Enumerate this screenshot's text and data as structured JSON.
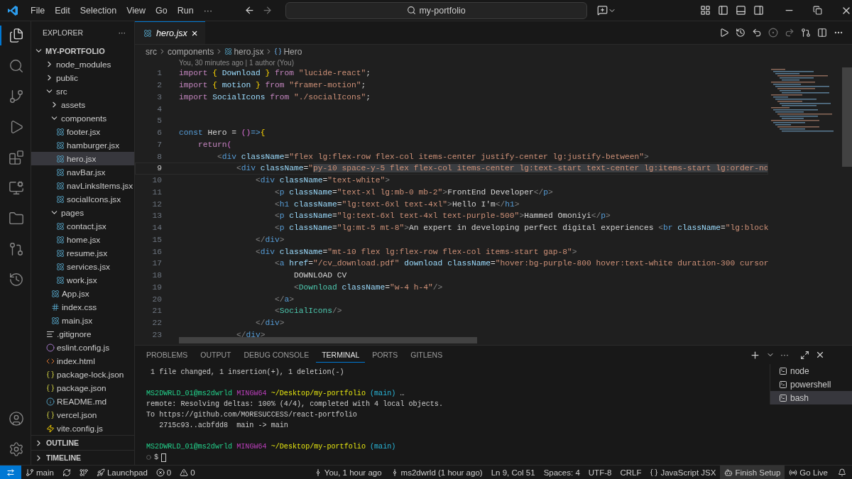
{
  "title_bar": {
    "menus": [
      "File",
      "Edit",
      "Selection",
      "View",
      "Go",
      "Run"
    ],
    "more": "···",
    "search": "my-portfolio"
  },
  "explorer": {
    "title": "EXPLORER",
    "more": "···",
    "root": "MY-PORTFOLIO",
    "items": [
      {
        "name": "node_modules",
        "kind": "folder",
        "expanded": false,
        "selected": false
      },
      {
        "name": "public",
        "kind": "folder",
        "expanded": false,
        "selected": false
      },
      {
        "name": "src",
        "kind": "folder",
        "expanded": true,
        "selected": false,
        "children": [
          {
            "name": "assets",
            "kind": "folder",
            "expanded": false,
            "selected": false
          },
          {
            "name": "components",
            "kind": "folder",
            "expanded": true,
            "selected": false,
            "children": [
              {
                "name": "footer.jsx",
                "kind": "react",
                "selected": false
              },
              {
                "name": "hamburger.jsx",
                "kind": "react",
                "selected": false
              },
              {
                "name": "hero.jsx",
                "kind": "react",
                "selected": true
              },
              {
                "name": "navBar.jsx",
                "kind": "react",
                "selected": false
              },
              {
                "name": "navLinksItems.jsx",
                "kind": "react",
                "selected": false
              },
              {
                "name": "socialIcons.jsx",
                "kind": "react",
                "selected": false
              }
            ]
          },
          {
            "name": "pages",
            "kind": "folder",
            "expanded": true,
            "selected": false,
            "children": [
              {
                "name": "contact.jsx",
                "kind": "react",
                "selected": false
              },
              {
                "name": "home.jsx",
                "kind": "react",
                "selected": false
              },
              {
                "name": "resume.jsx",
                "kind": "react",
                "selected": false
              },
              {
                "name": "services.jsx",
                "kind": "react",
                "selected": false
              },
              {
                "name": "work.jsx",
                "kind": "react",
                "selected": false
              }
            ]
          },
          {
            "name": "App.jsx",
            "kind": "react",
            "selected": false
          },
          {
            "name": "index.css",
            "kind": "css",
            "selected": false
          },
          {
            "name": "main.jsx",
            "kind": "react",
            "selected": false
          }
        ]
      },
      {
        "name": ".gitignore",
        "kind": "git",
        "selected": false
      },
      {
        "name": "eslint.config.js",
        "kind": "eslint",
        "selected": false
      },
      {
        "name": "index.html",
        "kind": "html",
        "selected": false
      },
      {
        "name": "package-lock.json",
        "kind": "json",
        "selected": false
      },
      {
        "name": "package.json",
        "kind": "json",
        "selected": false
      },
      {
        "name": "README.md",
        "kind": "info",
        "selected": false
      },
      {
        "name": "vercel.json",
        "kind": "json",
        "selected": false
      },
      {
        "name": "vite.config.js",
        "kind": "vite",
        "selected": false
      }
    ],
    "sections": [
      "OUTLINE",
      "TIMELINE"
    ]
  },
  "editor": {
    "tab": {
      "label": "hero.jsx",
      "close": "×"
    },
    "breadcrumbs": [
      "src",
      "components",
      "hero.jsx",
      "Hero"
    ],
    "blame": "You, 30 minutes ago | 1 author (You)",
    "lines": [
      {
        "number": "1",
        "current": false,
        "tokens": [
          {
            "text": "import",
            "kind": "control"
          },
          {
            "text": " {",
            "kind": "brace"
          },
          {
            "text": " Download",
            "kind": "variable"
          },
          {
            "text": " }",
            "kind": "brace"
          },
          {
            "text": " from",
            "kind": "control"
          },
          {
            "text": " \"lucide-react\"",
            "kind": "string"
          },
          {
            "text": ";",
            "kind": "plain"
          }
        ]
      },
      {
        "number": "2",
        "current": false,
        "tokens": [
          {
            "text": "import",
            "kind": "control"
          },
          {
            "text": " {",
            "kind": "brace"
          },
          {
            "text": " motion",
            "kind": "variable"
          },
          {
            "text": " }",
            "kind": "brace"
          },
          {
            "text": " from",
            "kind": "control"
          },
          {
            "text": " \"framer-motion\"",
            "kind": "string"
          },
          {
            "text": ";",
            "kind": "plain"
          }
        ]
      },
      {
        "number": "3",
        "current": false,
        "tokens": [
          {
            "text": "import",
            "kind": "control"
          },
          {
            "text": " SocialIcons",
            "kind": "variable"
          },
          {
            "text": " from",
            "kind": "control"
          },
          {
            "text": " \"./socialIcons\"",
            "kind": "string"
          },
          {
            "text": ";",
            "kind": "plain"
          }
        ]
      },
      {
        "number": "4",
        "current": false
      },
      {
        "number": "5",
        "current": false
      },
      {
        "number": "6",
        "current": false,
        "tokens": [
          {
            "text": "const",
            "kind": "storage"
          },
          {
            "text": " Hero = ",
            "kind": "plain"
          },
          {
            "text": "()",
            "kind": "paren"
          },
          {
            "text": "=>",
            "kind": "storage"
          },
          {
            "text": "{",
            "kind": "brace"
          }
        ]
      },
      {
        "number": "7",
        "current": false,
        "tokens": [
          {
            "text": "    return",
            "kind": "control"
          },
          {
            "text": "(",
            "kind": "paren"
          }
        ]
      },
      {
        "number": "8",
        "current": false,
        "tokens": [
          {
            "text": "        <",
            "kind": "bracket"
          },
          {
            "text": "div",
            "kind": "tag"
          },
          {
            "text": " className",
            "kind": "attribute"
          },
          {
            "text": "=",
            "kind": "plain"
          },
          {
            "text": "\"flex lg:flex-row flex-col items-center justify-center lg:justify-between\"",
            "kind": "string"
          },
          {
            "text": ">",
            "kind": "bracket"
          }
        ]
      },
      {
        "number": "9",
        "current": true,
        "tokens": [
          {
            "text": "            <",
            "kind": "bracket"
          },
          {
            "text": "div",
            "kind": "tag"
          },
          {
            "text": " className",
            "kind": "attribute"
          },
          {
            "text": "=",
            "kind": "plain"
          },
          {
            "text": "\"",
            "kind": "string"
          },
          {
            "text": "py-10 space-y-5 flex flex-col items-center lg:text-start text-center lg:items-start lg:order-no",
            "kind": "selection"
          }
        ]
      },
      {
        "number": "10",
        "current": false,
        "tokens": [
          {
            "text": "                <",
            "kind": "bracket"
          },
          {
            "text": "div",
            "kind": "tag"
          },
          {
            "text": " className",
            "kind": "attribute"
          },
          {
            "text": "=",
            "kind": "plain"
          },
          {
            "text": "\"text-white\"",
            "kind": "string"
          },
          {
            "text": ">",
            "kind": "bracket"
          }
        ]
      },
      {
        "number": "11",
        "current": false,
        "tokens": [
          {
            "text": "                    <",
            "kind": "bracket"
          },
          {
            "text": "p",
            "kind": "tag"
          },
          {
            "text": " className",
            "kind": "attribute"
          },
          {
            "text": "=",
            "kind": "plain"
          },
          {
            "text": "\"text-xl lg:mb-0 mb-2\"",
            "kind": "string"
          },
          {
            "text": ">",
            "kind": "bracket"
          },
          {
            "text": "FrontEnd Developer",
            "kind": "plain"
          },
          {
            "text": "</",
            "kind": "bracket"
          },
          {
            "text": "p",
            "kind": "tag"
          },
          {
            "text": ">",
            "kind": "bracket"
          }
        ]
      },
      {
        "number": "12",
        "current": false,
        "tokens": [
          {
            "text": "                    <",
            "kind": "bracket"
          },
          {
            "text": "h1",
            "kind": "tag"
          },
          {
            "text": " className",
            "kind": "attribute"
          },
          {
            "text": "=",
            "kind": "plain"
          },
          {
            "text": "\"lg:text-6xl text-4xl\"",
            "kind": "string"
          },
          {
            "text": ">",
            "kind": "bracket"
          },
          {
            "text": "Hello I'm",
            "kind": "plain"
          },
          {
            "text": "</",
            "kind": "bracket"
          },
          {
            "text": "h1",
            "kind": "tag"
          },
          {
            "text": ">",
            "kind": "bracket"
          }
        ]
      },
      {
        "number": "13",
        "current": false,
        "tokens": [
          {
            "text": "                    <",
            "kind": "bracket"
          },
          {
            "text": "p",
            "kind": "tag"
          },
          {
            "text": " className",
            "kind": "attribute"
          },
          {
            "text": "=",
            "kind": "plain"
          },
          {
            "text": "\"lg:text-6xl text-4xl text-purple-500\"",
            "kind": "string"
          },
          {
            "text": ">",
            "kind": "bracket"
          },
          {
            "text": "Hammed Omoniyi",
            "kind": "plain"
          },
          {
            "text": "</",
            "kind": "bracket"
          },
          {
            "text": "p",
            "kind": "tag"
          },
          {
            "text": ">",
            "kind": "bracket"
          }
        ]
      },
      {
        "number": "14",
        "current": false,
        "tokens": [
          {
            "text": "                    <",
            "kind": "bracket"
          },
          {
            "text": "p",
            "kind": "tag"
          },
          {
            "text": " className",
            "kind": "attribute"
          },
          {
            "text": "=",
            "kind": "plain"
          },
          {
            "text": "\"lg:mt-5 mt-8\"",
            "kind": "string"
          },
          {
            "text": ">",
            "kind": "bracket"
          },
          {
            "text": "An expert in developing perfect digital experiences ",
            "kind": "plain"
          },
          {
            "text": "<",
            "kind": "bracket"
          },
          {
            "text": "br",
            "kind": "tag"
          },
          {
            "text": " className",
            "kind": "attribute"
          },
          {
            "text": "=",
            "kind": "plain"
          },
          {
            "text": "\"lg:block",
            "kind": "string"
          }
        ]
      },
      {
        "number": "15",
        "current": false,
        "tokens": [
          {
            "text": "                </",
            "kind": "bracket"
          },
          {
            "text": "div",
            "kind": "tag"
          },
          {
            "text": ">",
            "kind": "bracket"
          }
        ]
      },
      {
        "number": "16",
        "current": false,
        "tokens": [
          {
            "text": "                <",
            "kind": "bracket"
          },
          {
            "text": "div",
            "kind": "tag"
          },
          {
            "text": " className",
            "kind": "attribute"
          },
          {
            "text": "=",
            "kind": "plain"
          },
          {
            "text": "\"mt-10 flex lg:flex-row flex-col items-start gap-8\"",
            "kind": "string"
          },
          {
            "text": ">",
            "kind": "bracket"
          }
        ]
      },
      {
        "number": "17",
        "current": false,
        "tokens": [
          {
            "text": "                    <",
            "kind": "bracket"
          },
          {
            "text": "a",
            "kind": "tag"
          },
          {
            "text": " href",
            "kind": "attribute"
          },
          {
            "text": "=",
            "kind": "plain"
          },
          {
            "text": "\"/cv_download.pdf\"",
            "kind": "string"
          },
          {
            "text": " download",
            "kind": "attribute"
          },
          {
            "text": " className",
            "kind": "attribute"
          },
          {
            "text": "=",
            "kind": "plain"
          },
          {
            "text": "\"hover:bg-purple-800 hover:text-white duration-300 cursor",
            "kind": "string"
          }
        ]
      },
      {
        "number": "18",
        "current": false,
        "tokens": [
          {
            "text": "                        DOWNLOAD CV",
            "kind": "plain"
          }
        ]
      },
      {
        "number": "19",
        "current": false,
        "tokens": [
          {
            "text": "                        <",
            "kind": "bracket"
          },
          {
            "text": "Download",
            "kind": "component"
          },
          {
            "text": " className",
            "kind": "attribute"
          },
          {
            "text": "=",
            "kind": "plain"
          },
          {
            "text": "\"w-4 h-4\"",
            "kind": "string"
          },
          {
            "text": "/>",
            "kind": "bracket"
          }
        ]
      },
      {
        "number": "20",
        "current": false,
        "tokens": [
          {
            "text": "                    </",
            "kind": "bracket"
          },
          {
            "text": "a",
            "kind": "tag"
          },
          {
            "text": ">",
            "kind": "bracket"
          }
        ]
      },
      {
        "number": "21",
        "current": false,
        "tokens": [
          {
            "text": "                    <",
            "kind": "bracket"
          },
          {
            "text": "SocialIcons",
            "kind": "component"
          },
          {
            "text": "/>",
            "kind": "bracket"
          }
        ]
      },
      {
        "number": "22",
        "current": false,
        "tokens": [
          {
            "text": "                </",
            "kind": "bracket"
          },
          {
            "text": "div",
            "kind": "tag"
          },
          {
            "text": ">",
            "kind": "bracket"
          }
        ]
      },
      {
        "number": "23",
        "current": false,
        "tokens": [
          {
            "text": "            </",
            "kind": "bracket"
          },
          {
            "text": "div",
            "kind": "tag"
          },
          {
            "text": ">",
            "kind": "bracket"
          }
        ]
      }
    ]
  },
  "panel": {
    "tabs": [
      {
        "label": "PROBLEMS",
        "selected": false
      },
      {
        "label": "OUTPUT",
        "selected": false
      },
      {
        "label": "DEBUG CONSOLE",
        "selected": false
      },
      {
        "label": "TERMINAL",
        "selected": true
      },
      {
        "label": "PORTS",
        "selected": false
      },
      {
        "label": "GITLENS",
        "selected": false
      }
    ],
    "more": "···",
    "terminal_lines": [
      {
        "kind": "text",
        "segments": [
          {
            "text": " 1 file changed, 1 insertion(+), 1 deletion(-)",
            "kind": "plain"
          }
        ]
      },
      {
        "kind": "blank"
      },
      {
        "kind": "text",
        "segments": [
          {
            "text": "MS2DWRLD_01@ms2dwrld",
            "kind": "user"
          },
          {
            "text": " MINGW64",
            "kind": "host"
          },
          {
            "text": " ~/Desktop/my-portfolio",
            "kind": "path"
          },
          {
            "text": " (main)",
            "kind": "branch"
          },
          {
            "text": " …",
            "kind": "plain"
          }
        ]
      },
      {
        "kind": "text",
        "segments": [
          {
            "text": "remote: Resolving deltas: 100% (4/4), completed with 4 local objects.",
            "kind": "plain"
          }
        ]
      },
      {
        "kind": "text",
        "segments": [
          {
            "text": "To https://github.com/MORESUCCESS/react-portfolio",
            "kind": "plain"
          }
        ]
      },
      {
        "kind": "text",
        "segments": [
          {
            "text": "   2715c93..acbfdd8  main -> main",
            "kind": "plain"
          }
        ]
      },
      {
        "kind": "blank"
      },
      {
        "kind": "text",
        "segments": [
          {
            "text": "MS2DWRLD_01@ms2dwrld",
            "kind": "user"
          },
          {
            "text": " MINGW64",
            "kind": "host"
          },
          {
            "text": " ~/Desktop/my-portfolio",
            "kind": "path"
          },
          {
            "text": " (main)",
            "kind": "branch"
          }
        ]
      },
      {
        "kind": "prompt",
        "segments": [
          {
            "text": "$",
            "kind": "plain"
          }
        ]
      }
    ],
    "terminals": [
      {
        "name": "node",
        "selected": false
      },
      {
        "name": "powershell",
        "selected": false
      },
      {
        "name": "bash",
        "selected": true
      }
    ]
  },
  "status_bar": {
    "left": [
      {
        "kind": "branch",
        "text": "main"
      },
      {
        "kind": "sync"
      },
      {
        "kind": "graph"
      },
      {
        "kind": "launchpad",
        "text": "Launchpad"
      },
      {
        "kind": "errors",
        "text": "0"
      },
      {
        "kind": "warnings",
        "text": "0"
      }
    ],
    "right": [
      {
        "kind": "blame",
        "text": "You, 1 hour ago",
        "highlighted": false
      },
      {
        "kind": "author",
        "text": "ms2dwrld (1 hour ago)",
        "highlighted": false
      },
      {
        "kind": "plain",
        "text": "Ln 9, Col 51",
        "highlighted": false
      },
      {
        "kind": "plain",
        "text": "Spaces: 4",
        "highlighted": false
      },
      {
        "kind": "plain",
        "text": "UTF-8",
        "highlighted": false
      },
      {
        "kind": "plain",
        "text": "CRLF",
        "highlighted": false
      },
      {
        "kind": "language",
        "text": "JavaScript JSX",
        "highlighted": false
      },
      {
        "kind": "assistant",
        "text": "Finish Setup",
        "highlighted": true
      },
      {
        "kind": "live",
        "text": "Go Live",
        "highlighted": false
      }
    ]
  }
}
